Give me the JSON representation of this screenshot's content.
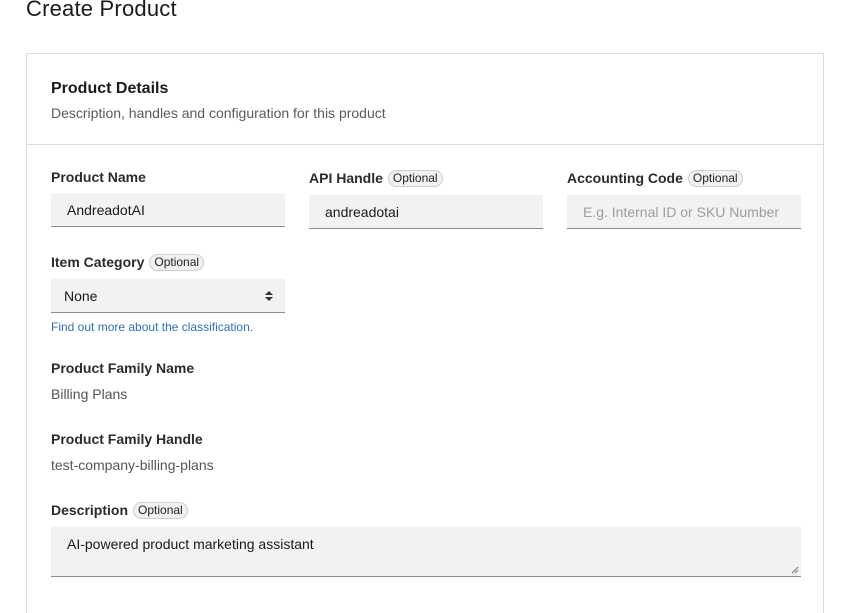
{
  "page": {
    "title": "Create Product"
  },
  "card": {
    "title": "Product Details",
    "subtitle": "Description, handles and configuration for this product"
  },
  "fields": {
    "product_name": {
      "label": "Product Name",
      "value": "AndreadotAI"
    },
    "api_handle": {
      "label": "API Handle",
      "badge": "Optional",
      "value": "andreadotai"
    },
    "accounting_code": {
      "label": "Accounting Code",
      "badge": "Optional",
      "placeholder": "E.g. Internal ID or SKU Number"
    },
    "item_category": {
      "label": "Item Category",
      "badge": "Optional",
      "selected": "None",
      "help_link": "Find out more about the classification."
    },
    "product_family_name": {
      "label": "Product Family Name",
      "value": "Billing Plans"
    },
    "product_family_handle": {
      "label": "Product Family Handle",
      "value": "test-company-billing-plans"
    },
    "description": {
      "label": "Description",
      "badge": "Optional",
      "value": "AI-powered product marketing assistant"
    }
  },
  "icons": {
    "select": "select-updown-icon",
    "resize": "textarea-resize-icon"
  },
  "colors": {
    "link": "#2f6fbd",
    "input_bg": "#f2f2f2",
    "border": "#dcdcdc"
  }
}
